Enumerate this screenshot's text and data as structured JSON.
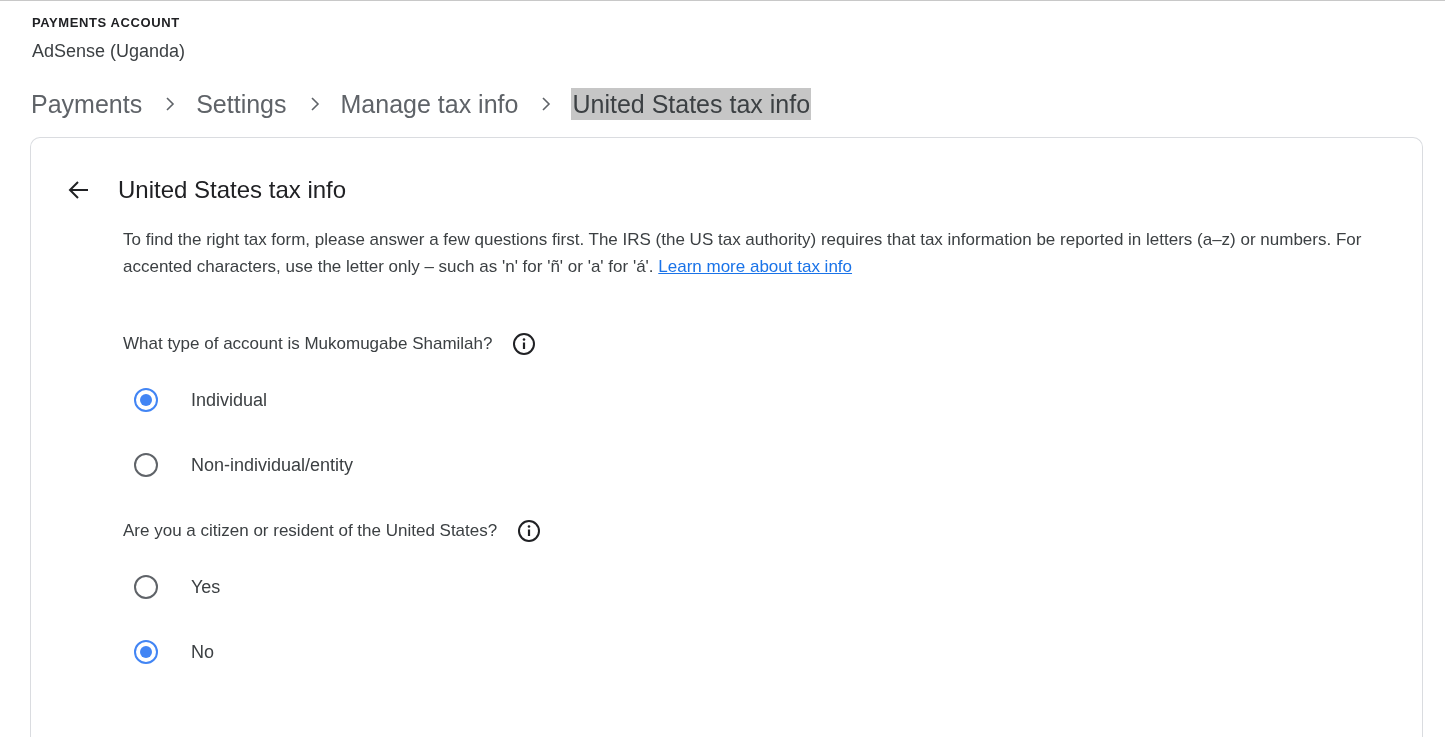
{
  "account": {
    "label": "PAYMENTS ACCOUNT",
    "name": "AdSense (Uganda)"
  },
  "breadcrumbs": [
    {
      "label": "Payments",
      "selected": false
    },
    {
      "label": "Settings",
      "selected": false
    },
    {
      "label": "Manage tax info",
      "selected": false
    },
    {
      "label": "United States tax info",
      "selected": true
    }
  ],
  "card": {
    "title": "United States tax info",
    "intro": "To find the right tax form, please answer a few questions first. The IRS (the US tax authority) requires that tax information be reported in letters (a–z) or numbers. For accented characters, use the letter only – such as 'n' for 'ñ' or 'a' for 'á'.",
    "link": "Learn more about tax info",
    "questions": [
      {
        "label": "What type of account is Mukomugabe Shamilah?",
        "options": [
          {
            "label": "Individual",
            "selected": true
          },
          {
            "label": "Non-individual/entity",
            "selected": false
          }
        ]
      },
      {
        "label": "Are you a citizen or resident of the United States?",
        "options": [
          {
            "label": "Yes",
            "selected": false
          },
          {
            "label": "No",
            "selected": true
          }
        ]
      }
    ]
  }
}
